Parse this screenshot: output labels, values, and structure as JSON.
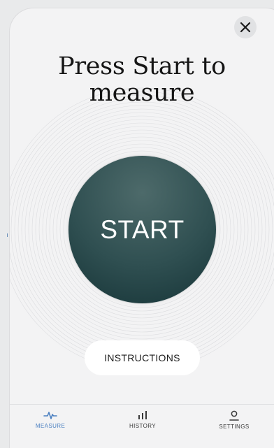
{
  "header": {
    "title": "Press Start to measure",
    "close_icon": "close-icon"
  },
  "measure": {
    "start_label": "START",
    "instructions_label": "INSTRUCTIONS"
  },
  "tabs": [
    {
      "label": "MEASURE",
      "icon": "heartbeat-icon",
      "active": true
    },
    {
      "label": "HISTORY",
      "icon": "bar-chart-icon",
      "active": false
    },
    {
      "label": "SETTINGS",
      "icon": "person-icon",
      "active": false
    }
  ],
  "colors": {
    "start_button": "#2f4f51",
    "active_tab": "#4a7fc0",
    "background": "#f3f3f4"
  }
}
